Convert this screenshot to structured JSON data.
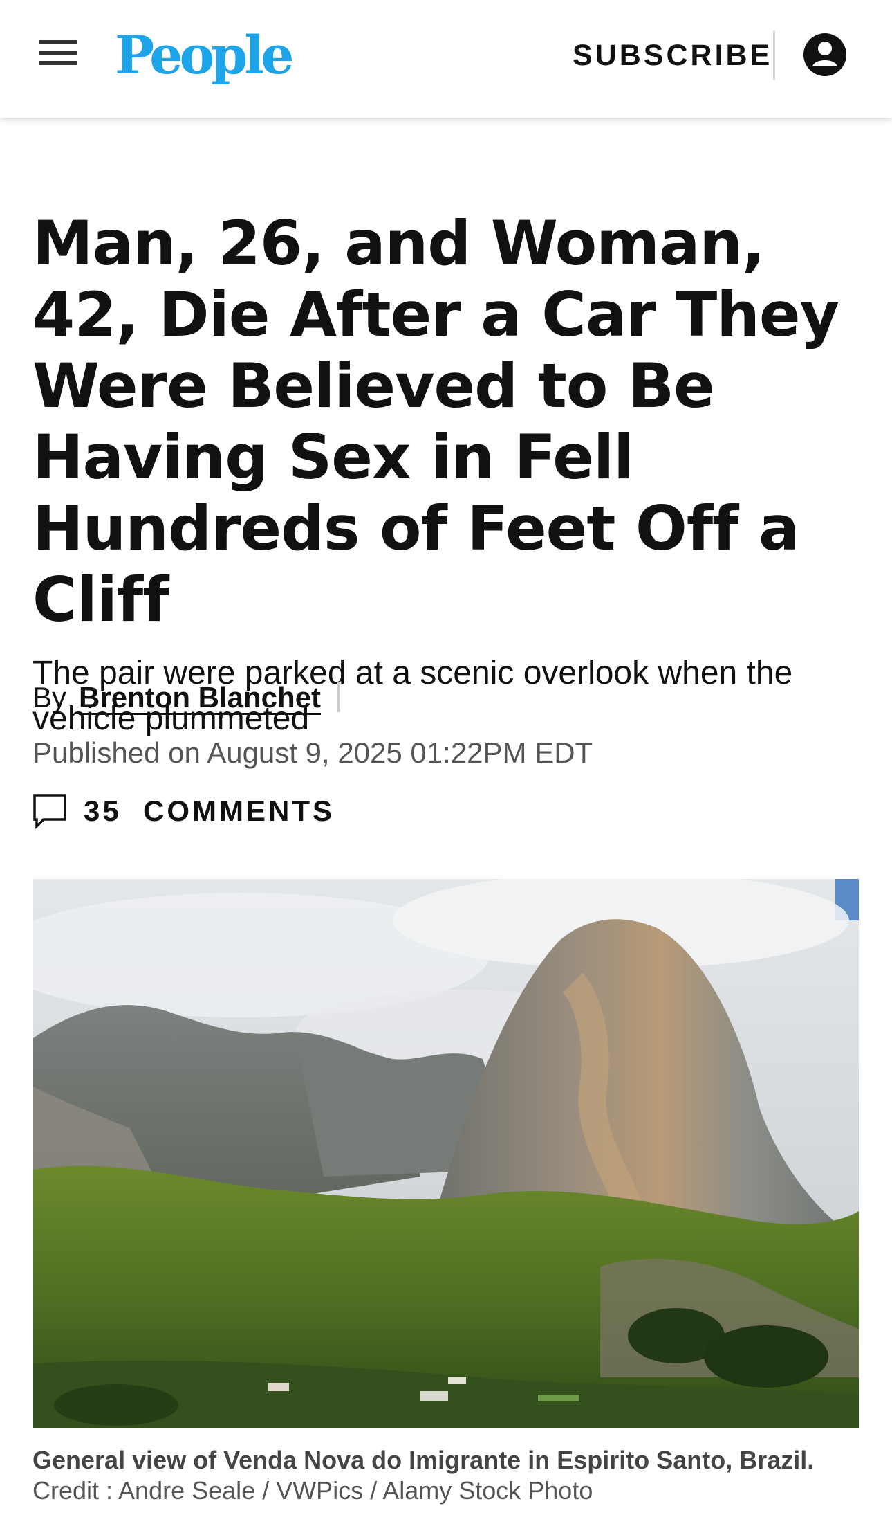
{
  "header": {
    "logo": "People",
    "subscribe_label": "SUBSCRIBE",
    "brand_color": "#1ea4e9",
    "menu_icon": "hamburger-menu-icon",
    "account_icon": "user-account-icon"
  },
  "article": {
    "headline": "Man, 26, and Woman, 42, Die After a Car They Were Believed to Be Having Sex in Fell Hundreds of Feet Off a Cliff",
    "dek": "The pair were parked at a scenic overlook when the vehicle plummeted",
    "byline_prefix": "By",
    "author": "Brenton Blanchet",
    "published": "Published on August 9, 2025 01:22PM EDT",
    "comments_label": "35  COMMENTS",
    "comment_icon": "comment-bubble-icon"
  },
  "image": {
    "caption": "General view of Venda Nova do Imigrante in Espirito Santo, Brazil.",
    "credit": "Credit : Andre Seale / VWPics / Alamy Stock Photo"
  }
}
